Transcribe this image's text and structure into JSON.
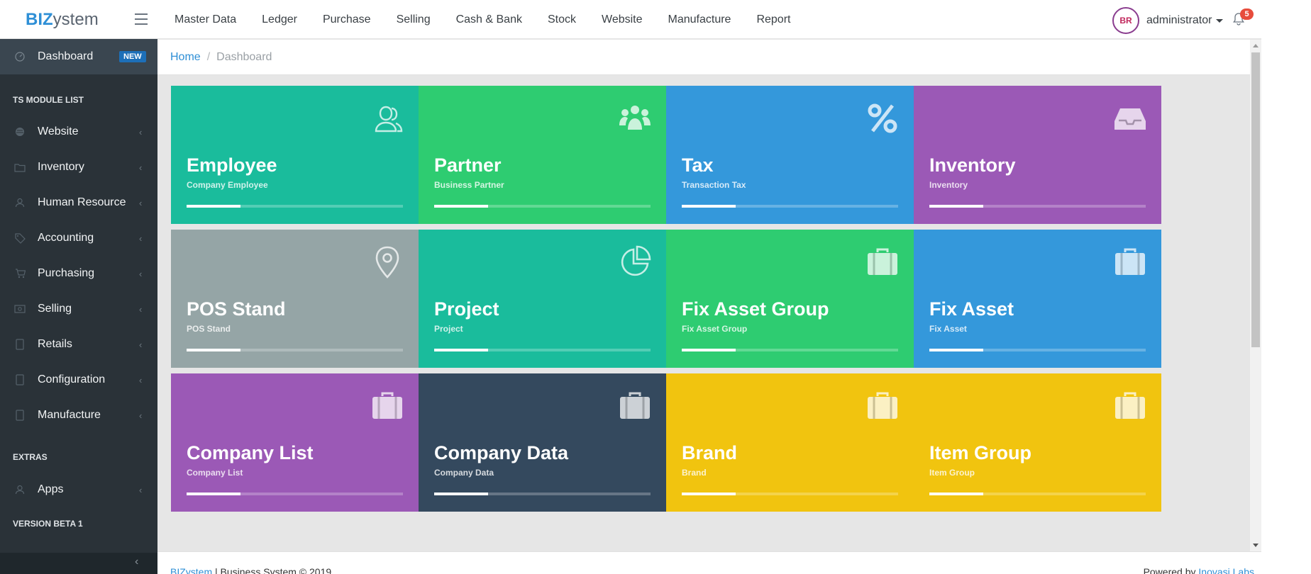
{
  "brand": {
    "part1": "BIZ",
    "part2": "ystem"
  },
  "topnav": [
    "Master Data",
    "Ledger",
    "Purchase",
    "Selling",
    "Cash & Bank",
    "Stock",
    "Website",
    "Manufacture",
    "Report"
  ],
  "user": {
    "avatar_text": "BR",
    "name": "administrator",
    "notifications": "5"
  },
  "sidebar": {
    "dashboard": {
      "label": "Dashboard",
      "badge": "NEW",
      "icon": "gauge-icon"
    },
    "module_heading": "TS MODULE LIST",
    "items": [
      {
        "label": "Website",
        "icon": "globe-icon"
      },
      {
        "label": "Inventory",
        "icon": "folder-icon"
      },
      {
        "label": "Human Resource",
        "icon": "user-icon"
      },
      {
        "label": "Accounting",
        "icon": "tag-icon"
      },
      {
        "label": "Purchasing",
        "icon": "cart-icon"
      },
      {
        "label": "Selling",
        "icon": "money-icon"
      },
      {
        "label": "Retails",
        "icon": "tablet-icon"
      },
      {
        "label": "Configuration",
        "icon": "tablet-icon"
      },
      {
        "label": "Manufacture",
        "icon": "tablet-icon"
      }
    ],
    "extras_heading": "EXTRAS",
    "extras": [
      {
        "label": "Apps",
        "icon": "user-icon"
      }
    ],
    "version": "VERSION BETA 1",
    "chevron": "‹"
  },
  "breadcrumb": {
    "home": "Home",
    "separator": "/",
    "current": "Dashboard"
  },
  "tiles": [
    {
      "title": "Employee",
      "subtitle": "Company Employee",
      "color": "#1abc9c",
      "icon": "users-outline-icon",
      "progress": 0.25
    },
    {
      "title": "Partner",
      "subtitle": "Business Partner",
      "color": "#2ecc71",
      "icon": "group-icon",
      "progress": 0.25
    },
    {
      "title": "Tax",
      "subtitle": "Transaction Tax",
      "color": "#3498db",
      "icon": "percent-icon",
      "progress": 0.25
    },
    {
      "title": "Inventory",
      "subtitle": "Inventory",
      "color": "#9b59b6",
      "icon": "inbox-icon",
      "progress": 0.25
    },
    {
      "title": "POS Stand",
      "subtitle": "POS Stand",
      "color": "#95a5a6",
      "icon": "map-pin-icon",
      "progress": 0.25
    },
    {
      "title": "Project",
      "subtitle": "Project",
      "color": "#1abc9c",
      "icon": "pie-chart-icon",
      "progress": 0.25
    },
    {
      "title": "Fix Asset Group",
      "subtitle": "Fix Asset Group",
      "color": "#2ecc71",
      "icon": "briefcase-icon",
      "progress": 0.25
    },
    {
      "title": "Fix Asset",
      "subtitle": "Fix Asset",
      "color": "#3498db",
      "icon": "briefcase-icon",
      "progress": 0.25
    },
    {
      "title": "Company List",
      "subtitle": "Company List",
      "color": "#9b59b6",
      "icon": "briefcase-icon",
      "progress": 0.25
    },
    {
      "title": "Company Data",
      "subtitle": "Company Data",
      "color": "#34495e",
      "icon": "briefcase-icon",
      "progress": 0.25
    },
    {
      "title": "Brand",
      "subtitle": "Brand",
      "color": "#f1c40f",
      "icon": "briefcase-icon",
      "progress": 0.25
    },
    {
      "title": "Item Group",
      "subtitle": "Item Group",
      "color": "#f1c40f",
      "icon": "briefcase-icon",
      "progress": 0.25
    }
  ],
  "footer": {
    "brand_link": "BIZystem",
    "left_text": " | Business System © 2019",
    "right_text": "Powered by ",
    "right_link": "Inovasi Labs"
  }
}
